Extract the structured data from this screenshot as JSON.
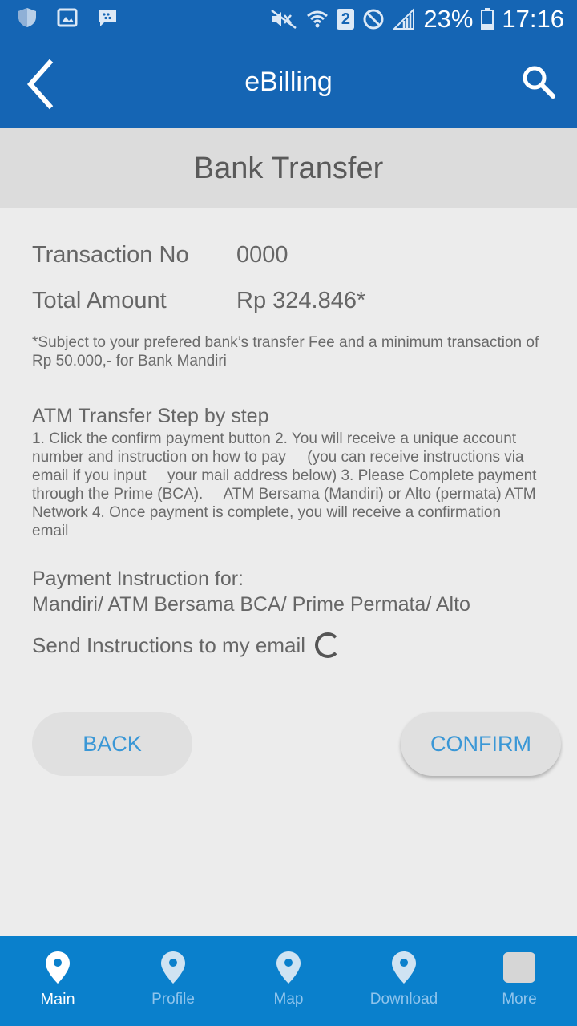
{
  "status_bar": {
    "battery": "23%",
    "time": "17:16",
    "sim": "2"
  },
  "app_bar": {
    "title": "eBilling"
  },
  "page": {
    "section_title": "Bank Transfer",
    "transaction_label": "Transaction No",
    "transaction_value": "0000",
    "amount_label": "Total Amount",
    "amount_value": "Rp 324.846*",
    "fee_note": "*Subject to your prefered bank’s transfer Fee and a minimum transaction of Rp 50.000,- for Bank Mandiri",
    "steps_title": "ATM Transfer Step by step",
    "steps_text": "1. Click the confirm payment button 2. You will receive a unique account number and instruction on how to pay     (you can receive instructions via email if you input     your mail address below) 3. Please Complete payment through the Prime (BCA).     ATM Bersama (Mandiri) or Alto (permata) ATM Network 4. Once payment is complete, you will receive a confirmation     email",
    "instruction_title": "Payment Instruction for:",
    "instruction_banks": "Mandiri/ ATM Bersama BCA/ Prime Permata/ Alto",
    "email_option_label": "Send Instructions to my email",
    "back_label": "BACK",
    "confirm_label": "CONFIRM"
  },
  "bottom_nav": {
    "items": [
      {
        "label": "Main",
        "icon": "location-pin-icon",
        "active": true
      },
      {
        "label": "Profile",
        "icon": "location-pin-icon",
        "active": false
      },
      {
        "label": "Map",
        "icon": "location-pin-icon",
        "active": false
      },
      {
        "label": "Download",
        "icon": "location-pin-icon",
        "active": false
      },
      {
        "label": "More",
        "icon": "more-box-icon",
        "active": false
      }
    ]
  },
  "colors": {
    "primary": "#1565b4",
    "nav": "#0a80cc",
    "button_text": "#3a97d6"
  }
}
